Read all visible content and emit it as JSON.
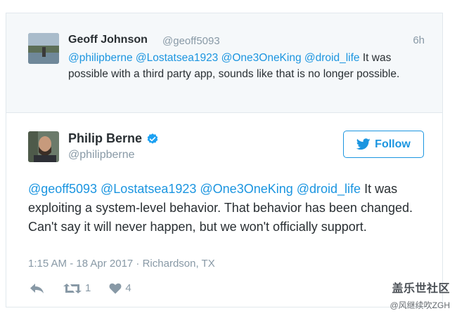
{
  "parent_tweet": {
    "name": "Geoff Johnson",
    "handle": "@geoff5093",
    "time": "6h",
    "mentions": "@philipberne @Lostatsea1923 @One3OneKing @droid_life",
    "text": " It was possible with a third party app, sounds like that is no longer possible."
  },
  "main_tweet": {
    "name": "Philip Berne",
    "handle": "@philipberne",
    "follow_label": "Follow",
    "mentions": "@geoff5093 @Lostatsea1923 @One3OneKing @droid_life",
    "text": " It was exploiting a system-level behavior. That behavior has been changed. Can't say it will never happen, but we won't officially support.",
    "meta": "1:15 AM - 18 Apr 2017 · Richardson, TX",
    "retweet_count": "1",
    "like_count": "4"
  },
  "watermark": {
    "title": "盖乐世社区",
    "subtitle": "@风继续吹ZGH"
  },
  "colors": {
    "link": "#1b95e0",
    "text": "#292f33",
    "muted": "#8899a6",
    "parent_bg": "#f5f8fa"
  },
  "icons": [
    "reply-icon",
    "retweet-icon",
    "heart-icon",
    "verified-badge-icon",
    "twitter-bird-icon"
  ]
}
